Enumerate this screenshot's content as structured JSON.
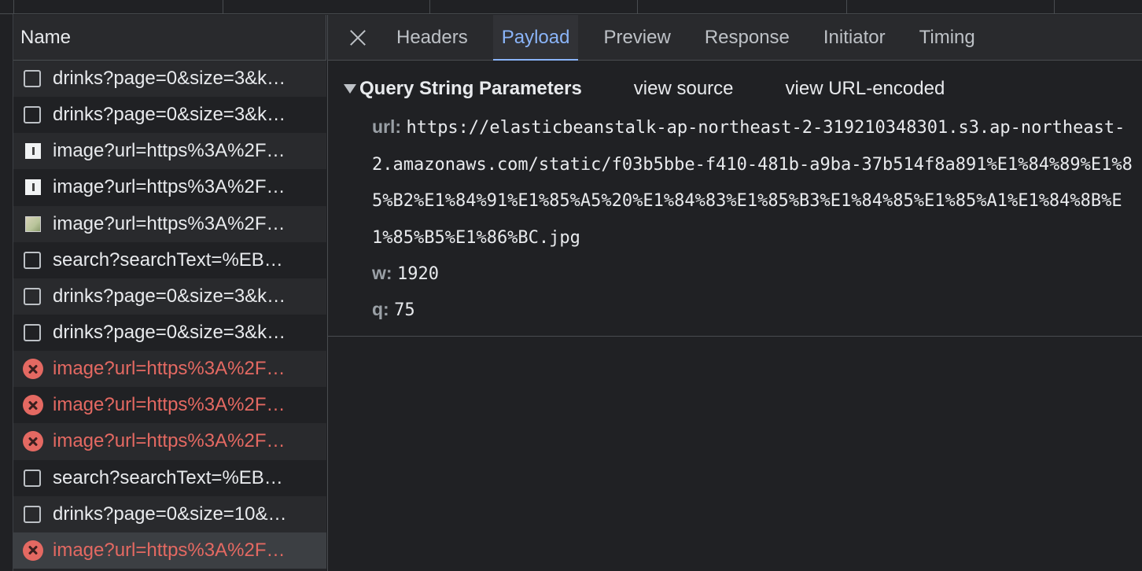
{
  "name_column": {
    "header": "Name"
  },
  "requests": [
    {
      "label": "drinks?page=0&size=3&k…",
      "icon": "document-icon",
      "status": "ok"
    },
    {
      "label": "drinks?page=0&size=3&k…",
      "icon": "document-icon",
      "status": "ok"
    },
    {
      "label": "image?url=https%3A%2F…",
      "icon": "image-icon",
      "status": "ok"
    },
    {
      "label": "image?url=https%3A%2F…",
      "icon": "image-icon",
      "status": "ok"
    },
    {
      "label": "image?url=https%3A%2F…",
      "icon": "image-thumbnail-icon",
      "status": "ok"
    },
    {
      "label": "search?searchText=%EB…",
      "icon": "document-icon",
      "status": "ok"
    },
    {
      "label": "drinks?page=0&size=3&k…",
      "icon": "document-icon",
      "status": "ok"
    },
    {
      "label": "drinks?page=0&size=3&k…",
      "icon": "document-icon",
      "status": "ok"
    },
    {
      "label": "image?url=https%3A%2F…",
      "icon": "error-icon",
      "status": "error"
    },
    {
      "label": "image?url=https%3A%2F…",
      "icon": "error-icon",
      "status": "error"
    },
    {
      "label": "image?url=https%3A%2F…",
      "icon": "error-icon",
      "status": "error"
    },
    {
      "label": "search?searchText=%EB…",
      "icon": "document-icon",
      "status": "ok"
    },
    {
      "label": "drinks?page=0&size=10&…",
      "icon": "document-icon",
      "status": "ok"
    },
    {
      "label": "image?url=https%3A%2F…",
      "icon": "error-icon",
      "status": "error",
      "selected": true
    }
  ],
  "tabs": {
    "headers": "Headers",
    "payload": "Payload",
    "preview": "Preview",
    "response": "Response",
    "initiator": "Initiator",
    "timing": "Timing",
    "active": "Payload"
  },
  "payload": {
    "section_title": "Query String Parameters",
    "view_source": "view source",
    "view_url_encoded": "view URL-encoded",
    "params": {
      "url_key": "url:",
      "url_value": "https://elasticbeanstalk-ap-northeast-2-319210348301.s3.ap-northeast-2.amazonaws.com/static/f03b5bbe-f410-481b-a9ba-37b514f8a891%E1%84%89%E1%85%B2%E1%84%91%E1%85%A5%20%E1%84%83%E1%85%B3%E1%84%85%E1%85%A1%E1%84%8B%E1%85%B5%E1%86%BC.jpg",
      "w_key": "w:",
      "w_value": "1920",
      "q_key": "q:",
      "q_value": "75"
    }
  },
  "colors": {
    "accent": "#8ab4f8",
    "error": "#e46962",
    "background": "#202124"
  }
}
